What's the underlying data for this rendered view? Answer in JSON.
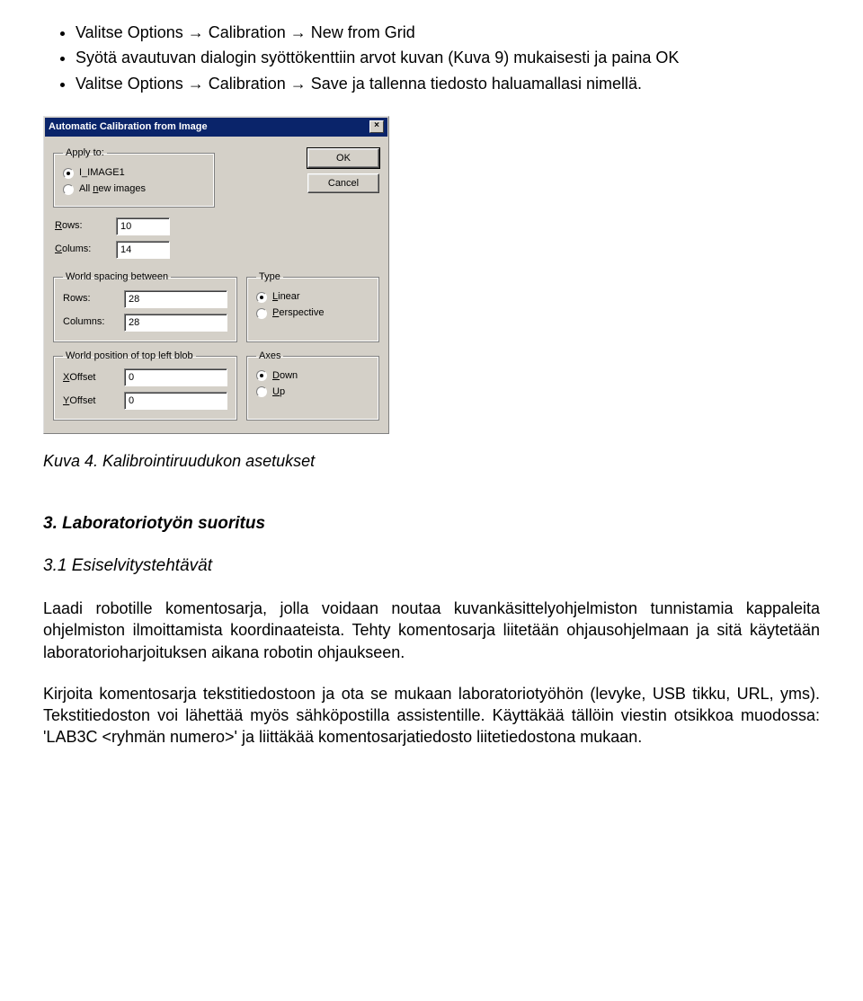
{
  "bullets": [
    "Valitse Options → Calibration → New from Grid",
    "Syötä avautuvan dialogin syöttökenttiin arvot kuvan (Kuva 9) mukaisesti ja paina OK",
    "Valitse Options → Calibration → Save ja tallenna tiedosto haluamallasi nimellä."
  ],
  "dialog": {
    "title": "Automatic Calibration from Image",
    "closeGlyph": "×",
    "applyTo": {
      "legend": "Apply to:",
      "opt1": "I_IMAGE1",
      "opt2": "All new images",
      "opt2_uchar": "n"
    },
    "buttons": {
      "ok": "OK",
      "cancel": "Cancel"
    },
    "rowsLabel": "Rows:",
    "rowsLabel_uchar": "R",
    "rowsValue": "10",
    "colsLabel": "Colums:",
    "colsLabel_uchar": "C",
    "colsValue": "14",
    "spacing": {
      "legend": "World spacing between",
      "rowsLabel": "Rows:",
      "rowsValue": "28",
      "colsLabel": "Columns:",
      "colsValue": "28"
    },
    "type": {
      "legend": "Type",
      "opt1": "Linear",
      "opt1_uchar": "L",
      "opt2": "Perspective",
      "opt2_uchar": "P"
    },
    "pos": {
      "legend": "World position of top left blob",
      "xLabel": "XOffset",
      "xLabel_uchar": "X",
      "xValue": "0",
      "yLabel": "YOffset",
      "yLabel_uchar": "Y",
      "yValue": "0"
    },
    "axes": {
      "legend": "Axes",
      "opt1": "Down",
      "opt1_uchar": "D",
      "opt2": "Up",
      "opt2_uchar": "U"
    }
  },
  "caption": "Kuva 4. Kalibrointiruudukon asetukset",
  "section": "3. Laboratoriotyön suoritus",
  "subsection": "3.1 Esiselvitystehtävät",
  "para1": "Laadi robotille komentosarja, jolla voidaan noutaa kuvankäsittelyohjelmiston tunnistamia kappaleita ohjelmiston ilmoittamista koordinaateista. Tehty komentosarja liitetään ohjausohjelmaan ja sitä käytetään laboratorioharjoituksen aikana robotin ohjaukseen.",
  "para2": "Kirjoita komentosarja tekstitiedostoon ja ota se mukaan laboratoriotyöhön (levyke, USB tikku, URL, yms). Tekstitiedoston voi lähettää myös sähköpostilla assistentille. Käyttäkää tällöin viestin otsikkoa muodossa: 'LAB3C <ryhmän numero>' ja liittäkää komentosarjatiedosto liitetiedostona mukaan."
}
